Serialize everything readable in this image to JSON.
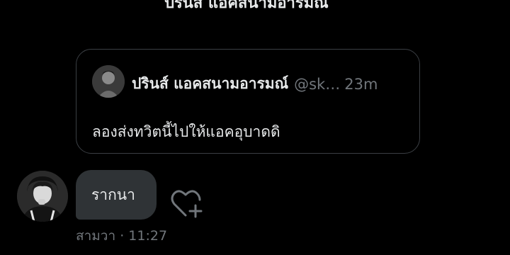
{
  "top_text": "ปรินส์ แอคสนามอารมณ์",
  "quoted_tweet": {
    "author_name": "ปรินส์ แอคสนามอารมณ์",
    "handle": "@sk…",
    "time": "23m",
    "text": "ลองส่งทวิตนี้ไปให้แอคอุบาดดิ"
  },
  "message": {
    "text": "รากนา",
    "sender": "สามวา",
    "separator": "·",
    "time": "11:27"
  },
  "icons": {
    "react": "heart-plus-icon",
    "avatar_quote": "avatar",
    "avatar_reply": "avatar"
  },
  "colors": {
    "background": "#000000",
    "bubble": "#2f3336",
    "border": "#3b3f44",
    "muted_text": "#71767b",
    "primary_text": "#e7e9ea"
  }
}
